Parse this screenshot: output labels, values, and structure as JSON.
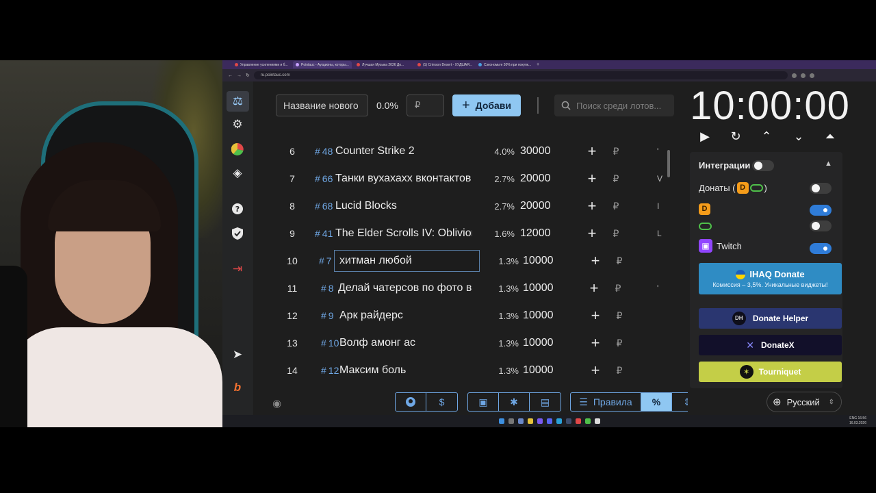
{
  "browser": {
    "tabs": [
      {
        "label": "Управление усилениями и б..."
      },
      {
        "label": "Pointauc - Аукционы, которы..."
      },
      {
        "label": "Лучшая Музыка 2026 До..."
      },
      {
        "label": "(1) Crimson Desert - ХУДШАЯ..."
      },
      {
        "label": "Сэкономьте 30% при покупк..."
      }
    ],
    "url": "ru.pointauc.com"
  },
  "toolbar": {
    "name_placeholder": "Название нового",
    "percent": "0.0%",
    "currency_placeholder": "₽",
    "add_label": "Добави",
    "search_placeholder": "Поиск среди лотов..."
  },
  "lots": [
    {
      "num": "6",
      "id": "48",
      "name": "Counter Strike 2",
      "pct": "4.0%",
      "amount": "30000",
      "extra": "'"
    },
    {
      "num": "7",
      "id": "66",
      "name": "Танки вухахахх вконтактов",
      "pct": "2.7%",
      "amount": "20000",
      "extra": "V"
    },
    {
      "num": "8",
      "id": "68",
      "name": "Lucid Blocks",
      "pct": "2.7%",
      "amount": "20000",
      "extra": "I"
    },
    {
      "num": "9",
      "id": "41",
      "name": "The Elder Scrolls IV: Oblivior",
      "pct": "1.6%",
      "amount": "12000",
      "extra": "L"
    },
    {
      "num": "10",
      "id": "7",
      "name": "хитман любой",
      "pct": "1.3%",
      "amount": "10000",
      "extra": ""
    },
    {
      "num": "11",
      "id": "8",
      "name": "Делай чатерсов по фото в с",
      "pct": "1.3%",
      "amount": "10000",
      "extra": "'"
    },
    {
      "num": "12",
      "id": "9",
      "name": "Арк райдерс",
      "pct": "1.3%",
      "amount": "10000",
      "extra": ""
    },
    {
      "num": "13",
      "id": "10",
      "name": "Волф амонг ас",
      "pct": "1.3%",
      "amount": "10000",
      "extra": ""
    },
    {
      "num": "14",
      "id": "12",
      "name": "Максим боль",
      "pct": "1.3%",
      "amount": "10000",
      "extra": ""
    }
  ],
  "bottom": {
    "rules_label": "Правила",
    "percent_symbol": "%",
    "dollar_symbol": "$"
  },
  "timer": {
    "value": "10:00:00"
  },
  "integrations": {
    "title": "Интеграции",
    "donations_label": "Донаты (",
    "donations_close": ")",
    "twitch_label": "Twitch",
    "ihaq_title": "IHAQ Donate",
    "ihaq_sub": "Комиссия – 3,5%. Уникальные виджеты!",
    "dh_badge": "DH",
    "dh_label": "Donate Helper",
    "dx_label": "DonateX",
    "tq_label": "Tourniquet",
    "da_letter": "D"
  },
  "language": {
    "value": "Русский"
  },
  "taskbar": {
    "time": "16:56",
    "date": "16.03.2026",
    "lang": "ENG"
  },
  "colors": {
    "accent": "#8fc7f2",
    "link": "#6fa7e4",
    "toggle_on": "#2f7cd8",
    "ihaq": "#2f8cc4",
    "donate_helper": "#2a3670",
    "donatex": "#12102a",
    "tourniquet": "#c4ce47",
    "exit": "#e04848"
  }
}
